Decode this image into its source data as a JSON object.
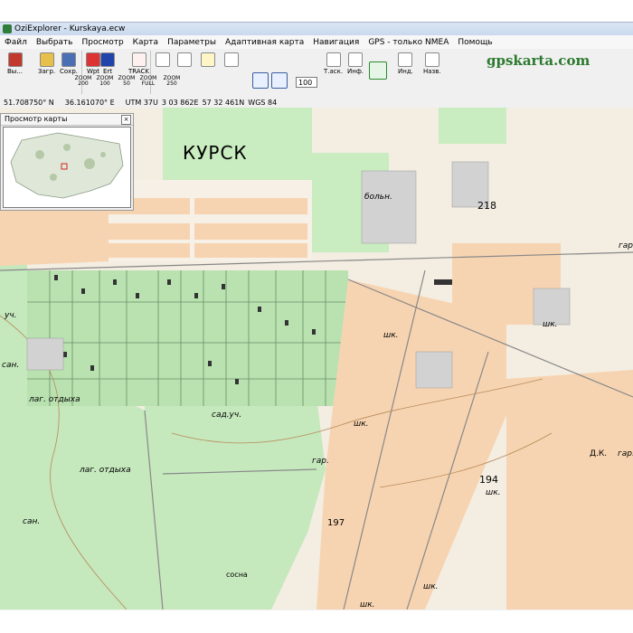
{
  "window": {
    "title": "OziExplorer - Kurskaya.ecw"
  },
  "menu": {
    "items": [
      "Файл",
      "Выбрать",
      "Просмотр",
      "Карта",
      "Параметры",
      "Адаптивная карта",
      "Навигация",
      "GPS - только NMEA",
      "Помощь"
    ]
  },
  "toolbar": {
    "exit_label": "Вы...",
    "load_label": "Загр.",
    "save_label": "Сохр.",
    "wpt_label": "Wpt",
    "ert_label": "Ert",
    "track_label": "TRACK",
    "zoom_value": "100",
    "track_nav_label": "Т.аск.",
    "info_label": "Инф.",
    "ind_label": "Инд.",
    "back_label": "Назв.",
    "zoom_buttons": [
      {
        "top": "ZOOM",
        "bottom": "200"
      },
      {
        "top": "ZOOM",
        "bottom": "100"
      },
      {
        "top": "ZOOM",
        "bottom": "50"
      },
      {
        "top": "ZOOM",
        "bottom": "FULL"
      },
      {
        "top": "ZOOM",
        "bottom": "250"
      }
    ],
    "brand": "gpskarta.com"
  },
  "statusbar": {
    "lat": "51.708750° N",
    "lon": "36.161070° E",
    "utm": "UTM  37U",
    "easting": "3 03 862E",
    "northing": "57 32 461N",
    "datum": "WGS 84"
  },
  "preview": {
    "title": "Просмотр карты",
    "close": "×"
  },
  "map": {
    "city_label": "КУРСК",
    "labels": {
      "boln": "больн.",
      "n218": "218",
      "uch": "уч.",
      "san1": "сан.",
      "lag1": "лаг. отдыха",
      "sad": "сад.уч.",
      "gar1": "гар.",
      "lag2": "лаг. отдыха",
      "san2": "сан.",
      "n197": "197",
      "sosna": "сосна",
      "shk1": "шк.",
      "shk2": "шк.",
      "shk3": "шк.",
      "n194": "194",
      "shk4": "шк.",
      "dk": "Д.К.",
      "gar2": "гар.",
      "shk5": "шк.",
      "shk6": "шк.",
      "gar3": "гар."
    }
  }
}
